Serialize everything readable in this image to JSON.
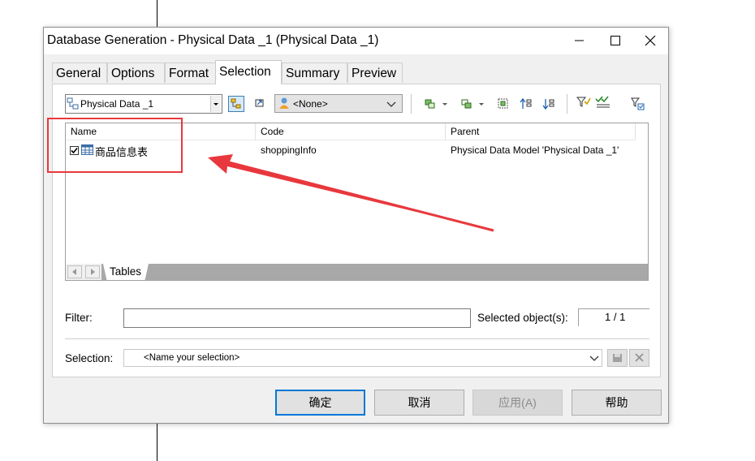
{
  "window": {
    "title": "Database Generation - Physical Data _1 (Physical Data _1)"
  },
  "tabs": [
    {
      "label": "General"
    },
    {
      "label": "Options"
    },
    {
      "label": "Format"
    },
    {
      "label": "Selection"
    },
    {
      "label": "Summary"
    },
    {
      "label": "Preview"
    }
  ],
  "active_tab": "Selection",
  "toolbar": {
    "model_select_value": "Physical Data _1",
    "owner_select_value": "<None>"
  },
  "grid": {
    "columns": [
      "Name",
      "Code",
      "Parent"
    ],
    "rows": [
      {
        "checked": true,
        "name": "商品信息表",
        "code": "shoppingInfo",
        "parent": "Physical Data Model 'Physical Data _1'"
      }
    ],
    "sheet_tab": "Tables"
  },
  "filter": {
    "label": "Filter:",
    "value": "",
    "selected_label": "Selected object(s):",
    "selected_value": "1 / 1"
  },
  "selection": {
    "label": "Selection:",
    "value": "<Name your selection>"
  },
  "buttons": {
    "ok": "确定",
    "cancel": "取消",
    "apply": "应用(A)",
    "help": "帮助"
  },
  "colors": {
    "annotation": "#e8383d",
    "accent": "#0078d7"
  }
}
